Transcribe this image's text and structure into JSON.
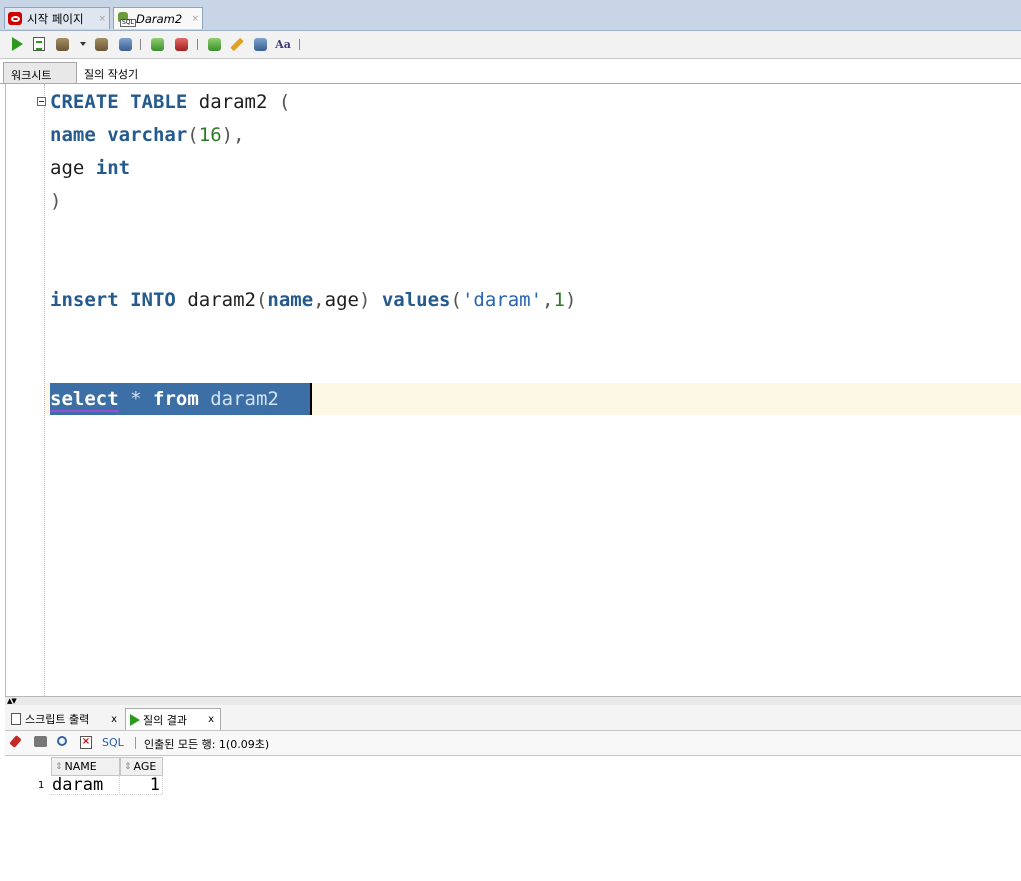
{
  "editor_tabs": [
    {
      "label": "시작 페이지",
      "icon": "oracle-icon",
      "close": "×"
    },
    {
      "label": "Daram2",
      "icon": "sql-worksheet-icon",
      "close": "×"
    }
  ],
  "sql_icon_label": "SQL",
  "sub_tabs": [
    "워크시트",
    "질의 작성기"
  ],
  "code": {
    "line1": {
      "kw1": "CREATE",
      "kw2": "TABLE",
      "name": "daram2",
      "paren": "("
    },
    "line2": {
      "col": "name",
      "type": "varchar",
      "open": "(",
      "num": "16",
      "close": "),"
    },
    "line3": {
      "col": "age",
      "type": "int"
    },
    "line4": {
      "paren": ")"
    },
    "line5": {
      "kw1": "insert",
      "kw2": "INTO",
      "table": "daram2",
      "open": "(",
      "col1": "name",
      "comma": ",",
      "col2": "age",
      "close": ")",
      "kw3": "values",
      "vopen": "(",
      "str": "'daram'",
      "vcomma": ",",
      "num": "1",
      "vclose": ")"
    },
    "line6": {
      "kw1": "select",
      "star": "*",
      "kw2": "from",
      "table": "daram2"
    }
  },
  "bottom_tabs": [
    {
      "label": "스크립트 출력",
      "close": "x"
    },
    {
      "label": "질의 결과",
      "close": "x"
    }
  ],
  "result_toolbar": {
    "sql_label": "SQL",
    "status": "인출된 모든 행: 1(0.09초)"
  },
  "results": {
    "columns": [
      "NAME",
      "AGE"
    ],
    "rows": [
      {
        "num": "1",
        "name": "daram",
        "age": "1"
      }
    ]
  }
}
